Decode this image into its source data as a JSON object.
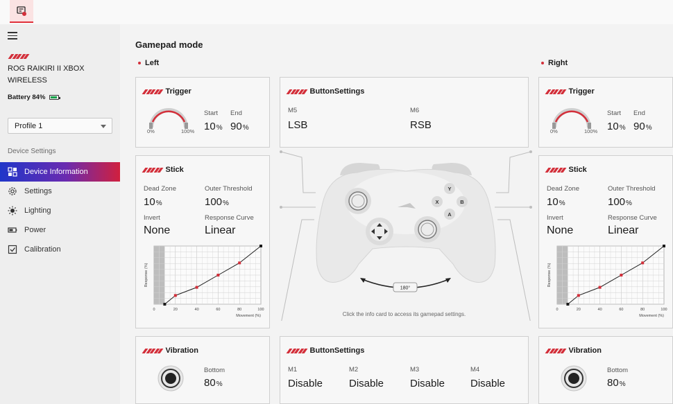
{
  "sidebar": {
    "device_name": "ROG RAIKIRI II XBOX WIRELESS",
    "battery_label": "Battery 84%",
    "battery_level": 0.84,
    "profile": "Profile 1",
    "section_label": "Device Settings",
    "items": [
      {
        "label": "Device Information",
        "icon": "device-info-icon",
        "active": true
      },
      {
        "label": "Settings",
        "icon": "gear-icon",
        "active": false
      },
      {
        "label": "Lighting",
        "icon": "sun-icon",
        "active": false
      },
      {
        "label": "Power",
        "icon": "battery-icon",
        "active": false
      },
      {
        "label": "Calibration",
        "icon": "calibration-icon",
        "active": false
      }
    ]
  },
  "main": {
    "title": "Gamepad mode",
    "left_label": "Left",
    "right_label": "Right",
    "info_text": "Click the info card to access its gamepad settings.",
    "rotate_label": "180°"
  },
  "left": {
    "trigger": {
      "title": "Trigger",
      "start_label": "Start",
      "end_label": "End",
      "start": "10",
      "end": "90",
      "unit": "%",
      "gauge_min": "0%",
      "gauge_max": "100%"
    },
    "stick": {
      "title": "Stick",
      "dead_zone_label": "Dead Zone",
      "dead_zone": "10",
      "outer_threshold_label": "Outer Threshold",
      "outer_threshold": "100",
      "unit": "%",
      "invert_label": "Invert",
      "invert": "None",
      "curve_label": "Response Curve",
      "curve": "Linear"
    },
    "vibration": {
      "title": "Vibration",
      "bottom_label": "Bottom",
      "bottom": "80",
      "unit": "%"
    }
  },
  "right": {
    "trigger": {
      "title": "Trigger",
      "start_label": "Start",
      "end_label": "End",
      "start": "10",
      "end": "90",
      "unit": "%",
      "gauge_min": "0%",
      "gauge_max": "100%"
    },
    "stick": {
      "title": "Stick",
      "dead_zone_label": "Dead Zone",
      "dead_zone": "10",
      "outer_threshold_label": "Outer Threshold",
      "outer_threshold": "100",
      "unit": "%",
      "invert_label": "Invert",
      "invert": "None",
      "curve_label": "Response Curve",
      "curve": "Linear"
    },
    "vibration": {
      "title": "Vibration",
      "bottom_label": "Bottom",
      "bottom": "80",
      "unit": "%"
    }
  },
  "button_settings_top": {
    "title": "ButtonSettings",
    "items": [
      {
        "label": "M5",
        "value": "LSB"
      },
      {
        "label": "M6",
        "value": "RSB"
      }
    ]
  },
  "button_settings_bottom": {
    "title": "ButtonSettings",
    "items": [
      {
        "label": "M1",
        "value": "Disable"
      },
      {
        "label": "M2",
        "value": "Disable"
      },
      {
        "label": "M3",
        "value": "Disable"
      },
      {
        "label": "M4",
        "value": "Disable"
      }
    ]
  },
  "controller_buttons": [
    "Y",
    "X",
    "B",
    "A"
  ],
  "colors": {
    "accent": "#d32f3a",
    "active_gradient_start": "#2036c9",
    "active_gradient_end": "#d0203e"
  },
  "chart_data": {
    "type": "line",
    "xlabel": "Movement (%)",
    "ylabel": "Response (%)",
    "xlim": [
      0,
      100
    ],
    "ylim": [
      0,
      100
    ],
    "x_ticks": [
      0,
      20,
      40,
      60,
      80,
      100
    ],
    "dead_zone": 10,
    "points": [
      [
        10,
        0
      ],
      [
        20,
        15
      ],
      [
        40,
        29
      ],
      [
        60,
        50
      ],
      [
        80,
        71
      ],
      [
        100,
        100
      ]
    ]
  }
}
